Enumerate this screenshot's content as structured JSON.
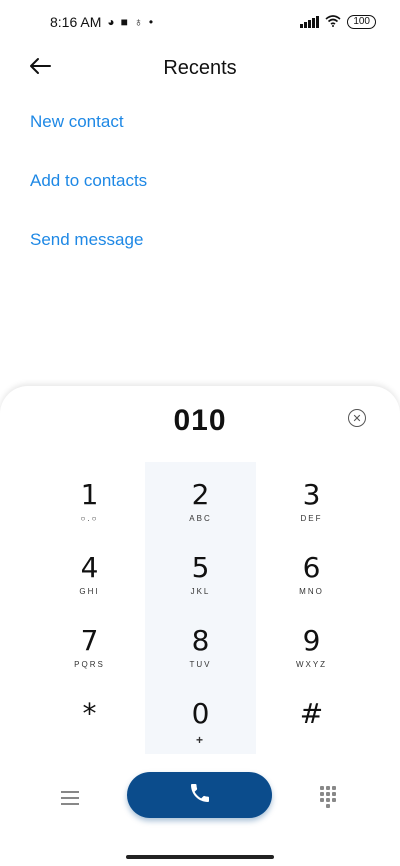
{
  "status_bar": {
    "time": "8:16 AM",
    "battery": "100",
    "icons": [
      "data-saver-icon",
      "square-icon",
      "assistant-icon",
      "dot-icon",
      "signal-icon",
      "wifi-icon",
      "battery-icon"
    ]
  },
  "header": {
    "title": "Recents",
    "back_icon": "arrow-left-icon"
  },
  "actions": [
    {
      "label": "New contact"
    },
    {
      "label": "Add to contacts"
    },
    {
      "label": "Send message"
    }
  ],
  "dialer": {
    "number": "010",
    "clear_icon": "clear-circle-icon",
    "keys": [
      {
        "digit": "1",
        "letters": "○.○"
      },
      {
        "digit": "2",
        "letters": "ABC"
      },
      {
        "digit": "3",
        "letters": "DEF"
      },
      {
        "digit": "4",
        "letters": "GHI"
      },
      {
        "digit": "5",
        "letters": "JKL"
      },
      {
        "digit": "6",
        "letters": "MNO"
      },
      {
        "digit": "7",
        "letters": "PQRS"
      },
      {
        "digit": "8",
        "letters": "TUV"
      },
      {
        "digit": "9",
        "letters": "WXYZ"
      },
      {
        "digit": "*",
        "letters": ""
      },
      {
        "digit": "0",
        "letters": "+"
      },
      {
        "digit": "#",
        "letters": ""
      }
    ]
  },
  "bottom_bar": {
    "menu_icon": "menu-icon",
    "call_icon": "phone-icon",
    "keypad_icon": "dialpad-icon",
    "call_color": "#0b4c8c"
  },
  "colors": {
    "accent": "#1e88e5",
    "call_button": "#0b4c8c"
  }
}
